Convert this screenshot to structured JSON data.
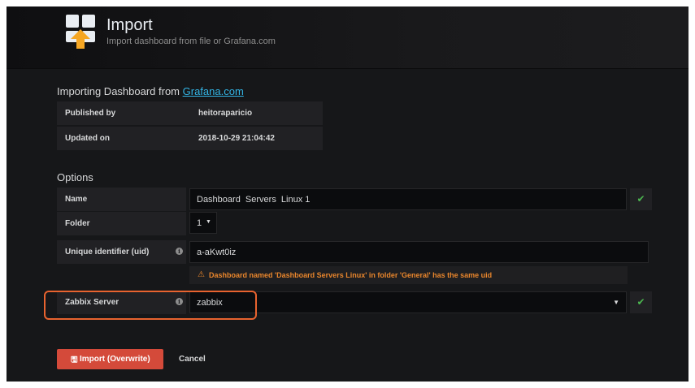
{
  "header": {
    "title": "Import",
    "subtitle": "Import dashboard from file or Grafana.com",
    "icon": "dashboard-import-icon"
  },
  "importing": {
    "heading_prefix": "Importing Dashboard from ",
    "heading_link": "Grafana.com",
    "rows": [
      {
        "label": "Published by",
        "value": "heitoraparicio"
      },
      {
        "label": "Updated on",
        "value": "2018-10-29 21:04:42"
      }
    ]
  },
  "options": {
    "heading": "Options",
    "name_label": "Name",
    "name_value": "Dashboard  Servers  Linux 1",
    "folder_label": "Folder",
    "folder_value": "1",
    "uid_label": "Unique identifier (uid)",
    "uid_value": "a-aKwt0iz",
    "uid_warning": "Dashboard named 'Dashboard Servers Linux' in folder 'General' has the same uid",
    "zabbix_label": "Zabbix Server",
    "zabbix_value": "zabbix"
  },
  "actions": {
    "import_label": "Import (Overwrite)",
    "cancel_label": "Cancel"
  },
  "colors": {
    "accent_link": "#33b5e5",
    "success": "#4cb850",
    "warning": "#e9862c",
    "danger_button": "#d44a3a",
    "highlight": "#e8632f"
  }
}
